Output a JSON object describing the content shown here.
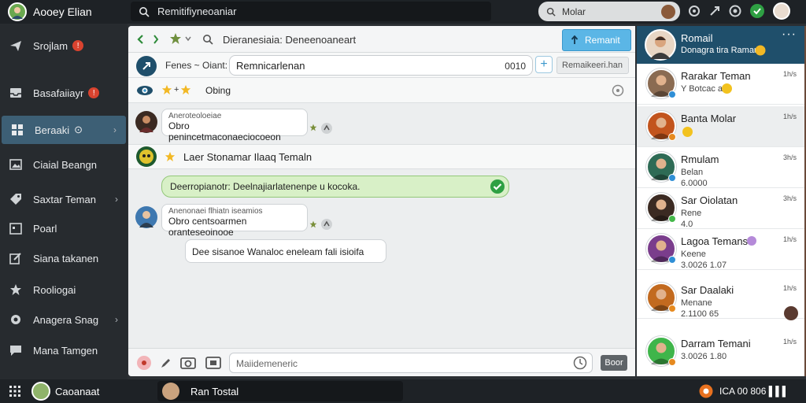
{
  "app": {
    "user_name": "Aooey Elian",
    "top_search_value": "Remitifiyneoaniar",
    "right_search_placeholder": "Molar"
  },
  "sidebar": {
    "items": [
      {
        "label": "Srojlam",
        "icon": "send-icon",
        "badge": "!"
      },
      {
        "label": "Basafaiiayr",
        "icon": "inbox-icon",
        "badge": "!"
      },
      {
        "label": "Beraaki",
        "icon": "grid-icon",
        "suffix": "⊙",
        "active": true
      },
      {
        "label": "Ciaial Beangn",
        "icon": "image-icon"
      },
      {
        "label": "Saxtar Teman",
        "icon": "tag-icon",
        "chevron": true
      },
      {
        "label": "Poarl",
        "icon": "calendar-icon"
      },
      {
        "label": "Siana takanen",
        "icon": "edit-icon"
      },
      {
        "label": "Rooliogai",
        "icon": "star-icon"
      },
      {
        "label": "Anagera Snag",
        "icon": "settings-icon",
        "chevron": true
      },
      {
        "label": "Mana Tamgen",
        "icon": "chat-icon"
      }
    ]
  },
  "chat": {
    "toolbar_search": "Dieranesiaia: Deneenoaneart",
    "primary_button": "Remanit",
    "header": {
      "label_prefix": "Fenes ~ Oiant:",
      "input_value": "Remnicarlenan",
      "count": "0010",
      "right_box": "Remaikeeri.han"
    },
    "stars_label": "Obing",
    "messages": [
      {
        "small": "Aneroteoloeiae",
        "text": "Obro penincetmaconaeciocoeon"
      },
      {
        "small": "Anenonaei flhiatn iseamios",
        "text": "Obro centsoarmen oranteseoinooe"
      }
    ],
    "system_text": "Laer Stonamar Ilaaq Temaln",
    "green_banner": "Deerropianotr: Deelnajiarlatenenpe u kocoka.",
    "reply_bubble": "Dee sisanoe Wanaloc eneleam fali isioifa",
    "composer_placeholder": "Maiidemeneric",
    "send_label": "Boor"
  },
  "contacts": {
    "head_name": "Romail",
    "head_sub": "Donagra tira Raman",
    "items": [
      {
        "name": "Rarakar Teman",
        "sub": [
          "Y Botcac aac"
        ],
        "time": "1h/s",
        "avatar_color": "#8a6b52",
        "status_color": "#2f8fd6",
        "emoji": true
      },
      {
        "name": "Banta Molar",
        "sub": [],
        "time": "1h/s",
        "avatar_color": "#c2541d",
        "status_color": "#e68a1f",
        "emoji": true,
        "selected": true
      },
      {
        "name": "Rmulam",
        "sub": [
          "Belan",
          "6.0000"
        ],
        "time": "3h/s",
        "avatar_color": "#2e6b55",
        "status_color": "#2f8fd6"
      },
      {
        "name": "Sar Oiolatan",
        "sub": [
          "Rene",
          "4.0"
        ],
        "time": "3h/s",
        "avatar_color": "#3b2a22",
        "status_color": "#44b84a"
      },
      {
        "name": "Lagoa Temans",
        "sub": [
          "Keene",
          "3.0026 1.07"
        ],
        "time": "1h/s",
        "avatar_color": "#7a3d8c",
        "status_color": "#2f8fd6",
        "tag": true
      },
      {
        "name": "Sar Daalaki",
        "sub": [
          "Menane",
          "2.1100 65"
        ],
        "time": "1h/s",
        "avatar_color": "#c26a1f",
        "status_color": "#e68a1f"
      },
      {
        "name": "Darram Temani",
        "sub": [
          "3.0026 1.80"
        ],
        "time": "1h/s",
        "avatar_color": "#3fb54a",
        "status_color": "#e68a1f"
      }
    ]
  },
  "bottombar": {
    "label": "Caoanaat",
    "call_label": "Ran Tostal",
    "right_text": "ICA 00 806 ▌▌▌"
  }
}
